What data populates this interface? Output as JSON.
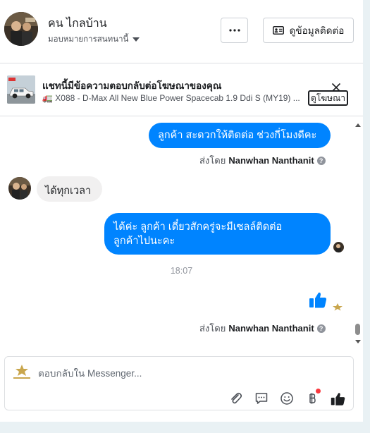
{
  "header": {
    "contact_name": "คน ไกลบ้าน",
    "assign_label": "มอบหมายการสนทนานี้",
    "more_label": "···",
    "contact_info_label": "ดูข้อมูลติดต่อ"
  },
  "ad_banner": {
    "title": "แชทนี้มีข้อความตอบกลับต่อโฆษณาของคุณ",
    "subtitle": "🚛 X088 - D-Max All New Blue Power Spacecab 1.9 Ddi S (MY19) ...",
    "view_ad_label": "ดูโฆษณา"
  },
  "messages": [
    {
      "direction": "outgoing",
      "text": "ลูกค้า สะดวกให้ติดต่อ ช่วงกี่โมงดีคะ"
    },
    {
      "direction": "meta",
      "sent_by_prefix": "ส่งโดย",
      "sent_by_name": "Nanwhan Nanthanit"
    },
    {
      "direction": "incoming",
      "text": "ได้ทุกเวลา"
    },
    {
      "direction": "outgoing",
      "line1": "ได้ค่ะ  ลูกค้า  เดี๋ยวสักครู่จะมีเซลล์ติดต่อ",
      "line2": "ลูกค้าไปนะคะ"
    },
    {
      "direction": "time",
      "text": "18:07"
    },
    {
      "direction": "outgoing",
      "type": "like-sticker"
    },
    {
      "direction": "meta",
      "sent_by_prefix": "ส่งโดย",
      "sent_by_name": "Nanwhan Nanthanit"
    }
  ],
  "composer": {
    "placeholder": "ตอบกลับใน Messenger..."
  },
  "colors": {
    "accent": "#0084ff",
    "incoming_bubble": "#f1f0f0",
    "border": "#dddfe2"
  },
  "icons": [
    "more-icon",
    "contact-card-icon",
    "close-icon",
    "help-icon",
    "like-icon",
    "attachment-icon",
    "saved-replies-icon",
    "emoji-icon",
    "baht-payment-icon",
    "chevron-up-icon",
    "chevron-down-icon"
  ]
}
